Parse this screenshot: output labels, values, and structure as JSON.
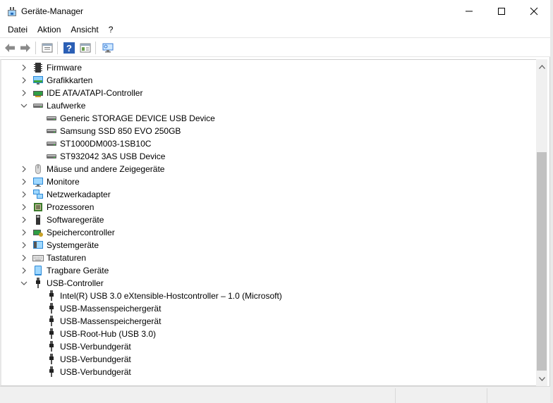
{
  "window": {
    "title": "Geräte-Manager",
    "icons": {
      "app": "device-manager-icon",
      "minimize": "minimize-icon",
      "maximize": "maximize-icon",
      "close": "close-icon"
    }
  },
  "menu": {
    "items": [
      "Datei",
      "Aktion",
      "Ansicht",
      "?"
    ]
  },
  "toolbar": {
    "icons": [
      "back-arrow-icon",
      "forward-arrow-icon",
      "properties-view-icon",
      "help-icon",
      "details-pane-icon",
      "monitor-scan-icon"
    ]
  },
  "tree": {
    "items": [
      {
        "label": "Firmware",
        "level": 0,
        "expanded": false,
        "icon": "firmware-icon"
      },
      {
        "label": "Grafikkarten",
        "level": 0,
        "expanded": false,
        "icon": "display-adapter-icon"
      },
      {
        "label": "IDE ATA/ATAPI-Controller",
        "level": 0,
        "expanded": false,
        "icon": "ide-controller-icon"
      },
      {
        "label": "Laufwerke",
        "level": 0,
        "expanded": true,
        "icon": "disk-drive-icon"
      },
      {
        "label": "Generic STORAGE DEVICE USB Device",
        "level": 1,
        "icon": "disk-drive-icon"
      },
      {
        "label": "Samsung SSD 850 EVO 250GB",
        "level": 1,
        "icon": "disk-drive-icon"
      },
      {
        "label": "ST1000DM003-1SB10C",
        "level": 1,
        "icon": "disk-drive-icon"
      },
      {
        "label": "ST932042 3AS USB Device",
        "level": 1,
        "icon": "disk-drive-icon"
      },
      {
        "label": "Mäuse und andere Zeigegeräte",
        "level": 0,
        "expanded": false,
        "icon": "mouse-icon"
      },
      {
        "label": "Monitore",
        "level": 0,
        "expanded": false,
        "icon": "monitor-icon"
      },
      {
        "label": "Netzwerkadapter",
        "level": 0,
        "expanded": false,
        "icon": "network-adapter-icon"
      },
      {
        "label": "Prozessoren",
        "level": 0,
        "expanded": false,
        "icon": "processor-icon"
      },
      {
        "label": "Softwaregeräte",
        "level": 0,
        "expanded": false,
        "icon": "software-device-icon"
      },
      {
        "label": "Speichercontroller",
        "level": 0,
        "expanded": false,
        "icon": "storage-controller-icon"
      },
      {
        "label": "Systemgeräte",
        "level": 0,
        "expanded": false,
        "icon": "system-device-icon"
      },
      {
        "label": "Tastaturen",
        "level": 0,
        "expanded": false,
        "icon": "keyboard-icon"
      },
      {
        "label": "Tragbare Geräte",
        "level": 0,
        "expanded": false,
        "icon": "portable-device-icon"
      },
      {
        "label": "USB-Controller",
        "level": 0,
        "expanded": true,
        "icon": "usb-icon"
      },
      {
        "label": "Intel(R) USB 3.0 eXtensible-Hostcontroller – 1.0 (Microsoft)",
        "level": 1,
        "icon": "usb-icon"
      },
      {
        "label": "USB-Massenspeichergerät",
        "level": 1,
        "icon": "usb-icon"
      },
      {
        "label": "USB-Massenspeichergerät",
        "level": 1,
        "icon": "usb-icon"
      },
      {
        "label": "USB-Root-Hub (USB 3.0)",
        "level": 1,
        "icon": "usb-icon"
      },
      {
        "label": "USB-Verbundgerät",
        "level": 1,
        "icon": "usb-icon"
      },
      {
        "label": "USB-Verbundgerät",
        "level": 1,
        "icon": "usb-icon"
      },
      {
        "label": "USB-Verbundgerät",
        "level": 1,
        "icon": "usb-icon"
      }
    ]
  }
}
